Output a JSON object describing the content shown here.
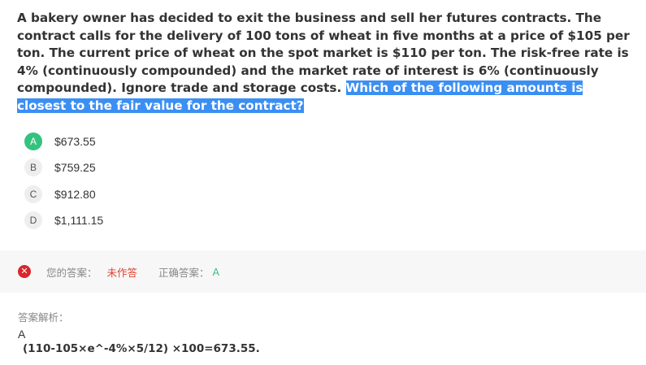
{
  "question": {
    "text": "A bakery owner has decided to exit the business and sell her futures contracts. The contract calls for the delivery of 100 tons of wheat in five months at a price of $105 per ton. The current price of wheat on the spot market is $110 per ton. The risk-free rate is 4% (continuously compounded) and the market rate of interest is 6% (continuously compounded). Ignore trade and storage costs. ",
    "highlight": "Which of the following amounts is closest to the fair value for the contract?"
  },
  "options": [
    {
      "letter": "A",
      "text": "$673.55"
    },
    {
      "letter": "B",
      "text": "$759.25"
    },
    {
      "letter": "C",
      "text": "$912.80"
    },
    {
      "letter": "D",
      "text": "$1,111.15"
    }
  ],
  "result": {
    "your_answer_label": "您的答案：",
    "your_answer_value": "未作答",
    "correct_answer_label": "正确答案：",
    "correct_answer_value": "A"
  },
  "analysis": {
    "label": "答案解析：",
    "answer": "A",
    "formula": "(110-105×e^-4%×5/12) ×100=673.55."
  },
  "colors": {
    "highlight": "#3b8ff3",
    "correct": "#35c27f",
    "error": "#d9262b",
    "unanswered": "#e0412f"
  },
  "icons": {
    "wrong": "x-circle-icon"
  }
}
